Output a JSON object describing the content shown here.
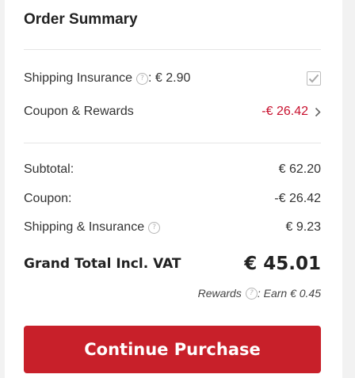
{
  "summary": {
    "title": "Order Summary",
    "shipping_insurance": {
      "label": "Shipping Insurance",
      "value": ": € 2.90",
      "checked": true
    },
    "coupon_rewards": {
      "label": "Coupon & Rewards",
      "value": "-€ 26.42"
    },
    "lines": [
      {
        "label": "Subtotal:",
        "value": "€ 62.20"
      },
      {
        "label": "Coupon:",
        "value": "-€ 26.42"
      },
      {
        "label": "Shipping & Insurance",
        "value": "€ 9.23"
      }
    ],
    "grand_total": {
      "label": "Grand Total Incl. VAT",
      "value": "€ 45.01"
    },
    "rewards": {
      "label": "Rewards",
      "value": ": Earn € 0.45"
    },
    "button_label": "Continue Purchase",
    "help_glyph": "?"
  },
  "colors": {
    "accent": "#c8202a",
    "discount": "#c8102e"
  },
  "icons": [
    "help-icon",
    "checkbox-checked-icon",
    "chevron-right-icon"
  ]
}
